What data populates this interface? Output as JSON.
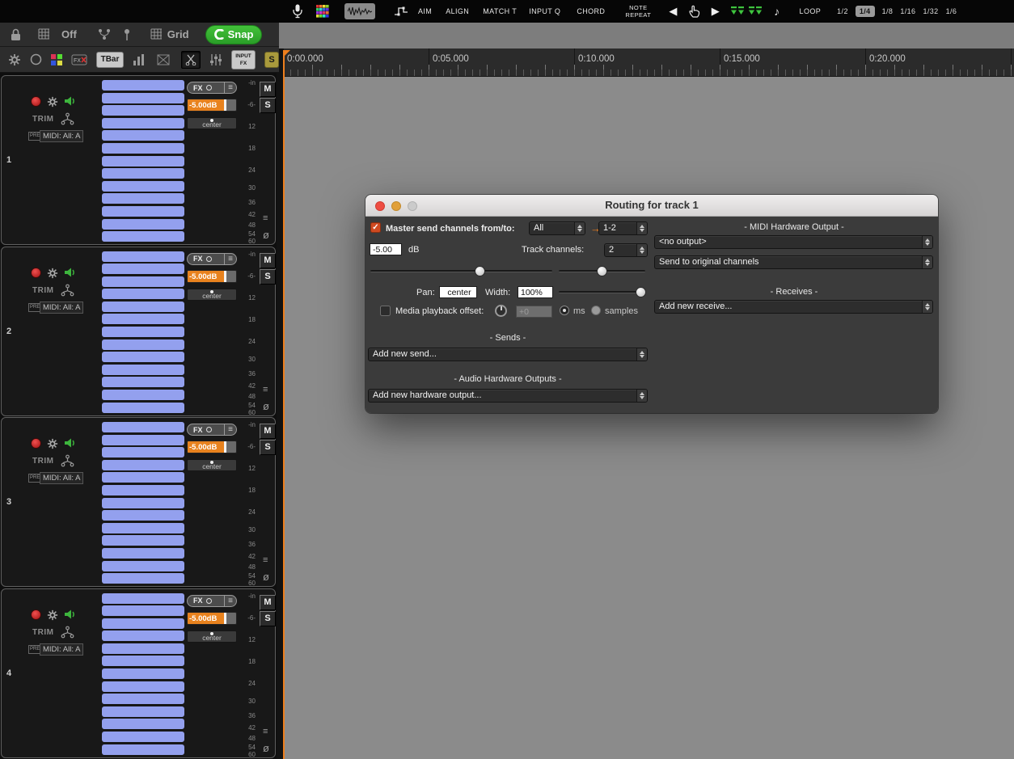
{
  "glyphs": {
    "prev": "◀",
    "play": "▶",
    "note": "♪",
    "menu": "≡",
    "check": "✓",
    "arrow": "→"
  },
  "top_toolbar": {
    "buttons": [
      "AIM",
      "ALIGN",
      "MATCH T",
      "INPUT Q",
      "CHORD"
    ],
    "note_repeat_label": "NOTE REPEAT",
    "loop_label": "LOOP",
    "divisions": [
      {
        "label": "1/2",
        "active": false
      },
      {
        "label": "1/4",
        "active": true
      },
      {
        "label": "1/8",
        "active": false
      },
      {
        "label": "1/16",
        "active": false
      },
      {
        "label": "1/32",
        "active": false
      },
      {
        "label": "1/6",
        "active": false
      }
    ]
  },
  "snap_toolbar": {
    "off_label": "Off",
    "grid_label": "Grid",
    "snap_label": "Snap"
  },
  "tool_row": {
    "tbar_label": "TBar",
    "input_fx_label": "INPUT FX",
    "s_label": "S"
  },
  "ruler": {
    "times": [
      "0:00.000",
      "0:05.000",
      "0:10.000",
      "0:15.000",
      "0:20.000"
    ]
  },
  "tracks": {
    "fx_label": "FX",
    "volume_label": "-5.00dB",
    "trim_label": "TRIM",
    "pan_label": "center",
    "pre_label": "PRE",
    "midi_label": "MIDI: All: A",
    "mute_label": "M",
    "solo_label": "S",
    "lanes_glyph": "≡",
    "phase_glyph": "ø",
    "meter_scale": [
      "-in",
      "-6-",
      "12",
      "18",
      "24",
      "30",
      "36",
      "42",
      "48",
      "54",
      "60"
    ],
    "items": [
      {
        "number": "1",
        "bars": 13
      },
      {
        "number": "2",
        "bars": 13
      },
      {
        "number": "3",
        "bars": 13
      },
      {
        "number": "4",
        "bars": 13
      }
    ]
  },
  "dialog": {
    "title": "Routing for track 1",
    "master_send": {
      "label": "Master send channels from/to:",
      "from": "All",
      "to": "1-2"
    },
    "volume": {
      "value": "-5.00",
      "unit": "dB"
    },
    "track_channels": {
      "label": "Track channels:",
      "value": "2"
    },
    "pan": {
      "label": "Pan:",
      "value": "center"
    },
    "width": {
      "label": "Width:",
      "value": "100%"
    },
    "playback_offset": {
      "label": "Media playback offset:",
      "value": "+0",
      "unit_ms": "ms",
      "unit_samples": "samples"
    },
    "midi_output": {
      "header": "-  MIDI Hardware Output  -",
      "device": "<no output>",
      "channel": "Send to original channels"
    },
    "receives": {
      "header": "-  Receives  -",
      "add": "Add new receive..."
    },
    "sends": {
      "header": "-  Sends  -",
      "add": "Add new send..."
    },
    "hw_outputs": {
      "header": "-  Audio Hardware Outputs  -",
      "add": "Add new hardware output..."
    }
  },
  "colors": {
    "accent_orange": "#e8821e",
    "snap_green": "#35b432",
    "bar_blue": "#93a0ee",
    "record_red": "#cc2222"
  }
}
